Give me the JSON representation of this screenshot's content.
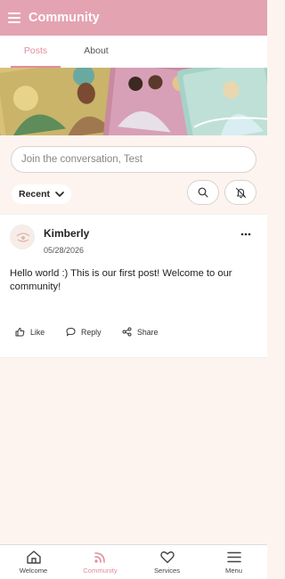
{
  "appbar": {
    "title": "Community"
  },
  "tabs": [
    {
      "label": "Posts",
      "active": true
    },
    {
      "label": "About",
      "active": false
    }
  ],
  "composer": {
    "placeholder": "Join the conversation, Test"
  },
  "sort": {
    "selected": "Recent"
  },
  "post": {
    "author": "Kimberly",
    "date": "05/28/2026",
    "body": "Hello world :) This is our first post! Welcome to our community!",
    "actions": {
      "like": "Like",
      "reply": "Reply",
      "share": "Share"
    }
  },
  "bottom_nav": [
    {
      "label": "Welcome",
      "icon": "home-icon"
    },
    {
      "label": "Community",
      "icon": "broadcast-icon",
      "active": true
    },
    {
      "label": "Services",
      "icon": "heart-icon"
    },
    {
      "label": "Menu",
      "icon": "menu-icon"
    }
  ],
  "colors": {
    "brand": "#e4a3b1",
    "accent": "#e38b9c",
    "background": "#fdf4ef"
  }
}
